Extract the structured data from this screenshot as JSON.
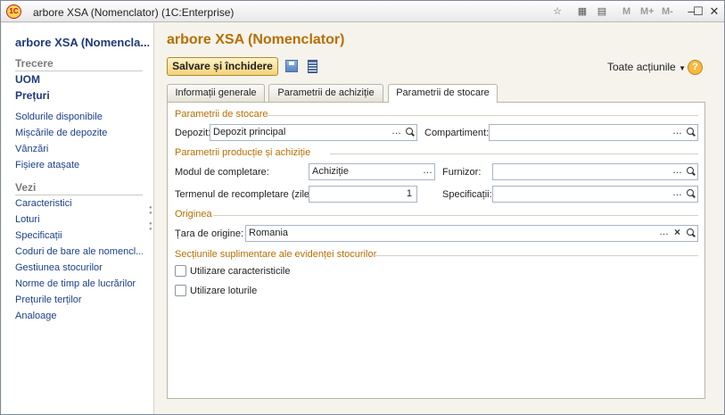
{
  "window": {
    "title": "arbore XSA (Nomenclator)  (1C:Enterprise)",
    "logo_text": "1C",
    "toolbar": {
      "m": "M",
      "m_plus": "M+",
      "m_minus": "M-"
    }
  },
  "nav": {
    "title": "arbore XSA (Nomencla...",
    "section_trecere": "Trecere",
    "trecere_items": [
      "UOM",
      "Prețuri"
    ],
    "links_1": [
      "Soldurile disponibile",
      "Mișcările de depozite",
      "Vânzări",
      "Fișiere atașate"
    ],
    "section_vezi": "Vezi",
    "links_2": [
      "Caracteristici",
      "Loturi",
      "Specificații",
      "Coduri de bare ale nomencl...",
      "Gestiunea stocurilor",
      "Norme de timp ale lucrărilor",
      "Prețurile terților",
      "Analoage"
    ]
  },
  "main": {
    "title": "arbore XSA (Nomenclator)",
    "save_close": "Salvare și închidere",
    "all_actions": "Toate acțiunile",
    "help": "?"
  },
  "tabs": [
    {
      "label": "Informații generale",
      "active": false
    },
    {
      "label": "Parametrii de achiziție",
      "active": false
    },
    {
      "label": "Parametrii de stocare",
      "active": true
    }
  ],
  "form": {
    "group_storage": "Parametrii de stocare",
    "depozit_label": "Depozit:",
    "depozit_value": "Depozit principal",
    "compartiment_label": "Compartiment:",
    "compartiment_value": "",
    "group_production": "Parametrii producție și achiziție",
    "mod_label": "Modul de completare:",
    "mod_value": "Achiziție",
    "furnizor_label": "Furnizor:",
    "furnizor_value": "",
    "termen_label": "Termenul de recompletare (zile):",
    "termen_value": "1",
    "specificatii_label": "Specificații:",
    "specificatii_value": "",
    "group_origin": "Originea",
    "tara_label": "Țara de origine:",
    "tara_value": "Romania",
    "group_sections": "Secțiunile suplimentare ale evidenței stocurilor",
    "chk_caract": {
      "label": "Utilizare caracteristicile",
      "checked": false
    },
    "chk_loturi": {
      "label": "Utilizare loturile",
      "checked": false
    }
  },
  "colors": {
    "accent": "#b86e00",
    "link": "#1a3f8b",
    "nav_title": "#1f3a7a",
    "button_bg": "#f3d27a"
  }
}
